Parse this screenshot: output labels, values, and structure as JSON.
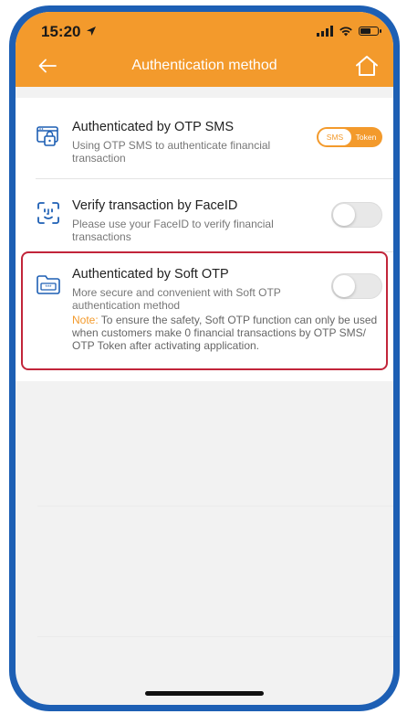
{
  "status_bar": {
    "time": "15:20"
  },
  "header": {
    "title": "Authentication method"
  },
  "items": [
    {
      "title": "Authenticated by OTP SMS",
      "description": "Using OTP SMS to authenticate financial transaction",
      "toggle": {
        "type": "segmented",
        "selected": "SMS",
        "other": "Token"
      }
    },
    {
      "title": "Verify transaction by FaceID",
      "description": " Please use your FaceID to verify financial transactions",
      "toggle": {
        "type": "switch",
        "on": false
      }
    },
    {
      "title": "Authenticated by Soft OTP",
      "description": "More secure and convenient with Soft OTP authentication method",
      "note_label": "Note:",
      "note_text": " To ensure the safety, Soft OTP function can only be used when customers make 0 financial transactions by OTP SMS/ OTP Token after activating application.",
      "toggle": {
        "type": "switch",
        "on": false
      },
      "highlighted": true
    }
  ],
  "colors": {
    "accent": "#f39a2c",
    "frame": "#1d5fb4",
    "highlight": "#c2253a"
  },
  "icons": [
    "back-arrow-icon",
    "home-icon",
    "otp-sms-icon",
    "faceid-icon",
    "soft-otp-icon"
  ]
}
